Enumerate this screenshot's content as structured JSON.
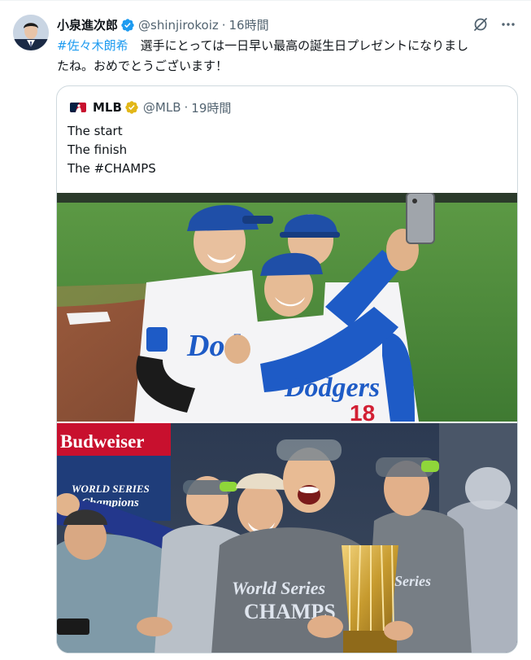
{
  "tweet": {
    "display_name": "小泉進次郎",
    "handle": "@shinjirokoiz",
    "separator": "·",
    "time": "16時間",
    "hashtag": "#佐々木朗希",
    "text_line1": "　選手にとっては一日早い最高の誕生日プレゼントになりまし",
    "text_line2": "たね。おめでとうございます！"
  },
  "quote": {
    "display_name": "MLB",
    "handle": "@MLB",
    "separator": "·",
    "time": "19時間",
    "lines": [
      "The start",
      "The finish",
      "The #CHAMPS"
    ]
  },
  "colors": {
    "link": "#1d9bf0",
    "text": "#0f1419",
    "secondary": "#536471",
    "border": "#cfd9de",
    "gold_badge": "#e2b719",
    "blue_badge": "#1d9bf0"
  },
  "icons": {
    "verified": "blue-check",
    "quote_badge": "gold-check",
    "grok": "grok-icon",
    "more": "more-dots"
  },
  "photo_labels": {
    "top_team": "Dodgers",
    "bottom_banner": "Budweiser",
    "bottom_logo": "World Series Champions",
    "bottom_shirt": "World Series CHAMPIONS"
  }
}
